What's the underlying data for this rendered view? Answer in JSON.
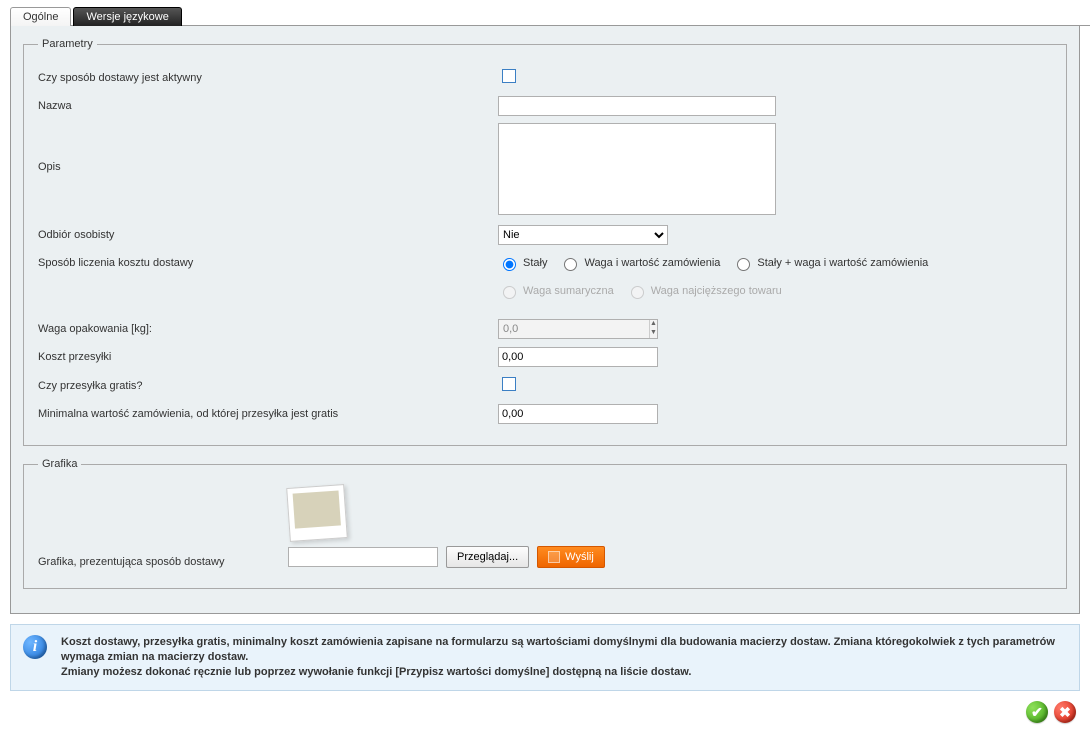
{
  "tabs": {
    "general": "Ogólne",
    "languages": "Wersje językowe"
  },
  "fieldsets": {
    "parameters": "Parametry",
    "graphics": "Grafika"
  },
  "labels": {
    "is_active": "Czy sposób dostawy jest aktywny",
    "name": "Nazwa",
    "description": "Opis",
    "personal_pickup": "Odbiór osobisty",
    "cost_method": "Sposób liczenia kosztu dostawy",
    "package_weight": "Waga opakowania [kg]:",
    "shipping_cost": "Koszt przesyłki",
    "free_shipping": "Czy przesyłka gratis?",
    "min_order_free": "Minimalna wartość zamówienia, od której przesyłka jest gratis",
    "graphic_presenting": "Grafika, prezentująca sposób dostawy"
  },
  "values": {
    "personal_pickup": "Nie",
    "package_weight": "0,0",
    "shipping_cost": "0,00",
    "min_order_free": "0,00"
  },
  "radios": {
    "fixed": "Stały",
    "weight_value": "Waga i wartość zamówienia",
    "fixed_plus": "Stały + waga i wartość zamówienia",
    "weight_sum": "Waga sumaryczna",
    "weight_heaviest": "Waga najcięższego towaru"
  },
  "buttons": {
    "browse": "Przeglądaj...",
    "send": "Wyślij"
  },
  "info": {
    "line1": "Koszt dostawy, przesyłka gratis, minimalny koszt zamówienia zapisane na formularzu są wartościami domyślnymi dla budowania macierzy dostaw. Zmiana któregokolwiek z tych parametrów wymaga zmian na macierzy dostaw.",
    "line2": "Zmiany możesz dokonać ręcznie lub poprzez wywołanie funkcji [Przypisz wartości domyślne] dostępną na liście dostaw."
  }
}
